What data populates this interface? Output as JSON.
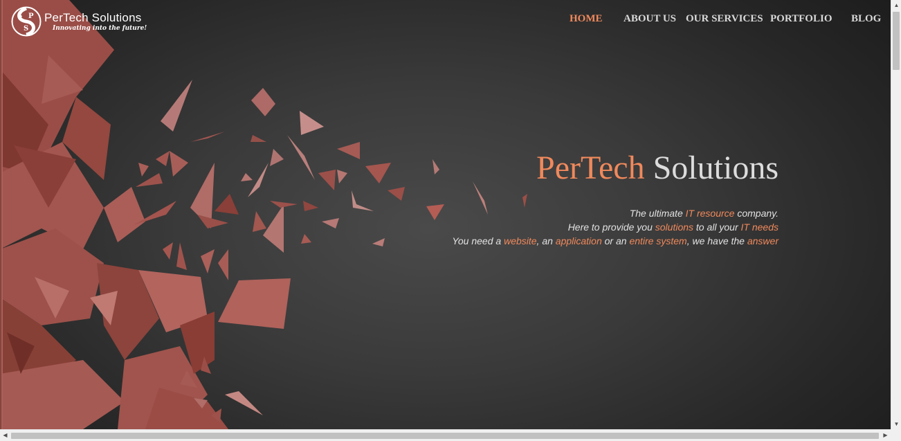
{
  "brand": {
    "name": "PerTech Solutions",
    "tagline": "Innovating into the future!",
    "logo_letters": [
      "S",
      "P",
      "S"
    ],
    "accent_color": "#f0895c"
  },
  "nav": {
    "items": [
      {
        "label": "HOME",
        "active": true
      },
      {
        "label": "ABOUT US",
        "active": false
      },
      {
        "label": "OUR SERVICES",
        "active": false
      },
      {
        "label": "PORTFOLIO",
        "active": false
      },
      {
        "label": "BLOG",
        "active": false
      }
    ]
  },
  "hero": {
    "title_accent": "PerTech",
    "title_rest": " Solutions",
    "line1": {
      "a": "The ultimate ",
      "b": "IT resource",
      "c": " company."
    },
    "line2": {
      "a": "Here to provide you ",
      "b": "solutions",
      "c": " to all your ",
      "d": "IT needs"
    },
    "line3": {
      "a": "You need a ",
      "b": "website",
      "c": ", an ",
      "d": "application",
      "e": " or an ",
      "f": "entire system",
      "g": ", we have the ",
      "h": "answer"
    }
  },
  "scrollbars": {
    "up_icon": "triangle-up-icon",
    "down_icon": "triangle-down-icon",
    "left_icon": "triangle-left-icon",
    "right_icon": "triangle-right-icon"
  }
}
